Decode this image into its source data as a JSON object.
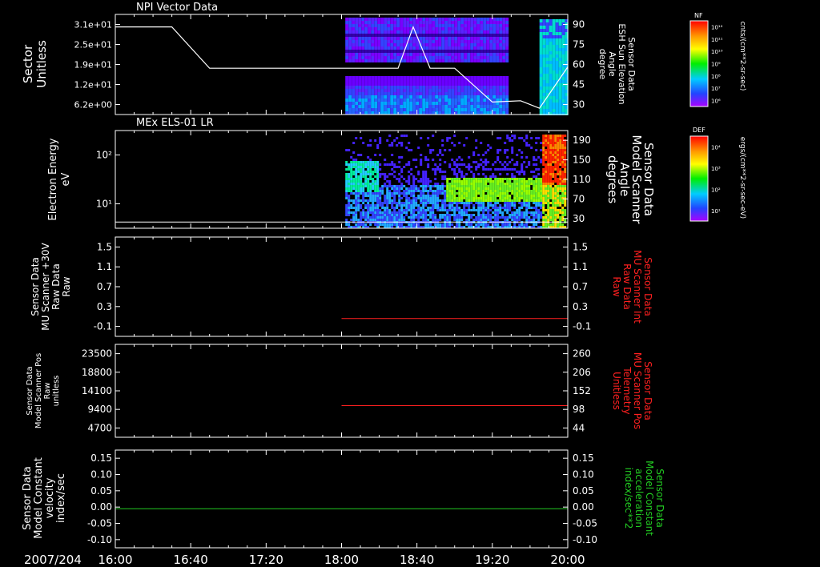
{
  "figure": {
    "date": "2007/204",
    "x_ticks": [
      "16:00",
      "16:40",
      "17:20",
      "18:00",
      "18:40",
      "19:20",
      "20:00"
    ]
  },
  "colors": {
    "background": "#000000",
    "axis": "#ffffff",
    "red": "#ff2020",
    "green": "#22cc22"
  },
  "colorbars": [
    {
      "label": "NF",
      "unit": "cnts/(cm**2-sr-sec)",
      "ticks": [
        "10¹²",
        "10¹¹",
        "10¹⁰",
        "10⁹",
        "10⁸",
        "10⁷",
        "10⁶"
      ]
    },
    {
      "label": "DEF",
      "unit": "ergs/(cm**2-sr-sec-eV)",
      "ticks": [
        "10⁴",
        "10³",
        "10²",
        "10¹"
      ]
    }
  ],
  "chart_data": [
    {
      "type": "heatmap",
      "title": "NPI Vector Data",
      "ylabel": [
        "Sector",
        "Unitless"
      ],
      "y_ticks": [
        "3.1e+01",
        "2.5e+01",
        "1.9e+01",
        "1.2e+01",
        "6.2e+00"
      ],
      "y2_ticks": [
        "90",
        "75",
        "60",
        "45",
        "30"
      ],
      "y2label": [
        "Sensor Data",
        "ESH Sun Elevation",
        "Angle",
        "degree"
      ],
      "line_series": {
        "x": [
          "16:00",
          "16:30",
          "16:50",
          "17:20",
          "18:00",
          "18:30",
          "18:38",
          "18:47",
          "19:00",
          "19:20",
          "19:35",
          "19:45",
          "20:00"
        ],
        "y": [
          80,
          80,
          47,
          47,
          47,
          47,
          80,
          47,
          47,
          20,
          21,
          15,
          48
        ]
      },
      "data_extent": [
        "18:02",
        "20:00"
      ]
    },
    {
      "type": "heatmap",
      "title": "MEx ELS-01 LR",
      "ylabel": [
        "Electron Energy",
        "eV"
      ],
      "y_ticks": [
        "10²",
        "10¹"
      ],
      "y2_ticks": [
        "190",
        "150",
        "110",
        "70",
        "30"
      ],
      "y2label": [
        "Sensor Data",
        "Model Scanner",
        "Angle",
        "degrees"
      ],
      "line_series": {
        "x": [
          "16:00",
          "20:00"
        ],
        "y": [
          12,
          12
        ]
      },
      "data_extent": [
        "18:02",
        "20:00"
      ]
    },
    {
      "type": "line",
      "ylabel": [
        "Sensor Data",
        "MU Scanner +30V",
        "Raw Data",
        "Raw"
      ],
      "y_ticks": [
        "1.5",
        "1.1",
        "0.7",
        "0.3",
        "-0.1"
      ],
      "y2_ticks": [
        "1.5",
        "1.1",
        "0.7",
        "0.3",
        "-0.1"
      ],
      "y2label": [
        "Sensor Data",
        "MU Scanner Int",
        "Raw Data",
        "Raw"
      ],
      "ylim": [
        -0.4,
        1.5
      ],
      "series": [
        {
          "x": [
            "18:00",
            "20:00"
          ],
          "y": [
            -0.06,
            -0.06
          ]
        }
      ]
    },
    {
      "type": "line",
      "ylabel": [
        "Sensor Data",
        "Model Scanner Pos",
        "Raw",
        "unitless"
      ],
      "y_ticks": [
        "23500",
        "18800",
        "14100",
        "9400",
        "4700"
      ],
      "y2_ticks": [
        "260",
        "206",
        "152",
        "98",
        "44"
      ],
      "y2label": [
        "Sensor Data",
        "MU Scanner Pos",
        "Telemetry",
        "Unitless"
      ],
      "ylim": [
        0,
        23500
      ],
      "series": [
        {
          "x": [
            "18:00",
            "20:00"
          ],
          "y": [
            8000,
            8000
          ]
        }
      ]
    },
    {
      "type": "line",
      "ylabel": [
        "Sensor Data",
        "Model Constant",
        "velocity",
        "index/sec"
      ],
      "y_ticks": [
        "0.15",
        "0.10",
        "0.05",
        "0.00",
        "-0.05",
        "-0.10"
      ],
      "y2_ticks": [
        "0.15",
        "0.10",
        "0.05",
        "0.00",
        "-0.05",
        "-0.10"
      ],
      "y2label": [
        "Sensor Data",
        "Model Constant",
        "acceleration",
        "index/sec**2"
      ],
      "ylim": [
        -0.1,
        0.15
      ],
      "series": [
        {
          "x": [
            "16:00",
            "20:00"
          ],
          "y": [
            0.0,
            0.0
          ]
        }
      ]
    }
  ]
}
